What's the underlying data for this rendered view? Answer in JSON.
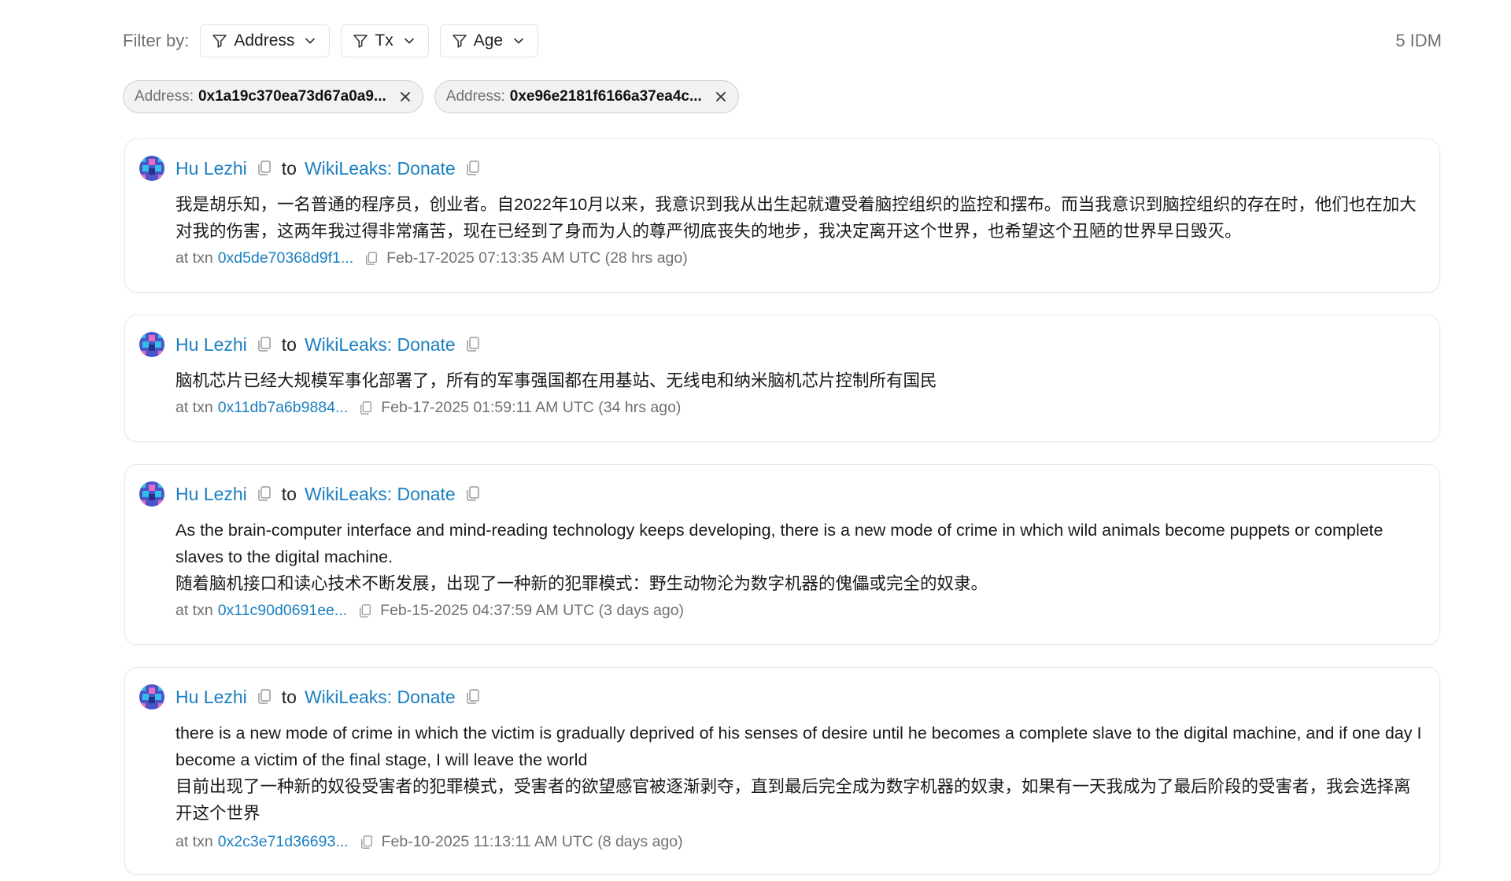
{
  "toolbar": {
    "filter_label": "Filter by:",
    "filters": [
      {
        "label": "Address"
      },
      {
        "label": "Tx"
      },
      {
        "label": "Age"
      }
    ],
    "count": "5 IDM"
  },
  "chips": [
    {
      "key": "Address:",
      "value": "0x1a19c370ea73d67a0a9..."
    },
    {
      "key": "Address:",
      "value": "0xe96e2181f6166a37ea4c..."
    }
  ],
  "messages": [
    {
      "from": "Hu Lezhi",
      "to_word": "to",
      "to": "WikiLeaks: Donate",
      "lines": [
        "我是胡乐知，一名普通的程序员，创业者。自2022年10月以来，我意识到我从出生起就遭受着脑控组织的监控和摆布。而当我意识到脑控组织的存在时，他们也在加大对我的伤害，这两年我过得非常痛苦，现在已经到了身而为人的尊严彻底丧失的地步，我决定离开这个世界，也希望这个丑陋的世界早日毁灭。"
      ],
      "at_txn": "at txn",
      "txn": "0xd5de70368d9f1...",
      "time": "Feb-17-2025 07:13:35 AM UTC (28 hrs ago)"
    },
    {
      "from": "Hu Lezhi",
      "to_word": "to",
      "to": "WikiLeaks: Donate",
      "lines": [
        "脑机芯片已经大规模军事化部署了，所有的军事强国都在用基站、无线电和纳米脑机芯片控制所有国民"
      ],
      "at_txn": "at txn",
      "txn": "0x11db7a6b9884...",
      "time": "Feb-17-2025 01:59:11 AM UTC (34 hrs ago)"
    },
    {
      "from": "Hu Lezhi",
      "to_word": "to",
      "to": "WikiLeaks: Donate",
      "lines": [
        "As the brain-computer interface and mind-reading technology keeps developing, there is a new mode of crime in which wild animals become puppets or complete slaves to the digital machine.",
        "随着脑机接口和读心技术不断发展，出现了一种新的犯罪模式：野生动物沦为数字机器的傀儡或完全的奴隶。"
      ],
      "at_txn": "at txn",
      "txn": "0x11c90d0691ee...",
      "time": "Feb-15-2025 04:37:59 AM UTC (3 days ago)"
    },
    {
      "from": "Hu Lezhi",
      "to_word": "to",
      "to": "WikiLeaks: Donate",
      "lines": [
        "there is a new mode of crime in which the victim is gradually deprived of his senses of desire until he becomes a complete slave to the digital machine, and if one day I become a victim of the final stage, I will leave the world",
        "目前出现了一种新的奴役受害者的犯罪模式，受害者的欲望感官被逐渐剥夺，直到最后完全成为数字机器的奴隶，如果有一天我成为了最后阶段的受害者，我会选择离开这个世界"
      ],
      "at_txn": "at txn",
      "txn": "0x2c3e71d36693...",
      "time": "Feb-10-2025 11:13:11 AM UTC (8 days ago)"
    }
  ],
  "colors": {
    "link": "#1a7fc1",
    "muted": "#707070",
    "avatar_primary": "#4a55c8",
    "avatar_secondary": "#33c0e8"
  },
  "icons": {
    "filter": "funnel-icon",
    "chevron": "chevron-down-icon",
    "close": "close-icon",
    "copy": "copy-icon",
    "avatar": "blockie-avatar"
  }
}
